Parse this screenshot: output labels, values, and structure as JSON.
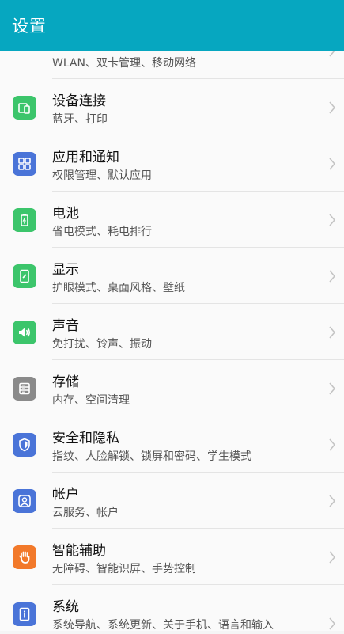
{
  "header": {
    "title": "设置"
  },
  "items": [
    {
      "key": "wlan",
      "title": "",
      "subtitle": "WLAN、双卡管理、移动网络",
      "icon": "wifi-icon",
      "color": "#4a74d8"
    },
    {
      "key": "device",
      "title": "设备连接",
      "subtitle": "蓝牙、打印",
      "icon": "device-connection-icon",
      "color": "#3cc56b"
    },
    {
      "key": "apps",
      "title": "应用和通知",
      "subtitle": "权限管理、默认应用",
      "icon": "apps-grid-icon",
      "color": "#4a74d8"
    },
    {
      "key": "battery",
      "title": "电池",
      "subtitle": "省电模式、耗电排行",
      "icon": "battery-icon",
      "color": "#3cc56b"
    },
    {
      "key": "display",
      "title": "显示",
      "subtitle": "护眼模式、桌面风格、壁纸",
      "icon": "display-icon",
      "color": "#3cc56b"
    },
    {
      "key": "sound",
      "title": "声音",
      "subtitle": "免打扰、铃声、振动",
      "icon": "speaker-icon",
      "color": "#3cc56b"
    },
    {
      "key": "storage",
      "title": "存储",
      "subtitle": "内存、空间清理",
      "icon": "storage-icon",
      "color": "#8a8a8a"
    },
    {
      "key": "security",
      "title": "安全和隐私",
      "subtitle": "指纹、人脸解锁、锁屏和密码、学生模式",
      "icon": "shield-icon",
      "color": "#4a74d8"
    },
    {
      "key": "accounts",
      "title": "帐户",
      "subtitle": "云服务、帐户",
      "icon": "account-icon",
      "color": "#4a74d8"
    },
    {
      "key": "assist",
      "title": "智能辅助",
      "subtitle": "无障碍、智能识屏、手势控制",
      "icon": "hand-icon",
      "color": "#f2792a"
    },
    {
      "key": "system",
      "title": "系统",
      "subtitle": "系统导航、系统更新、关于手机、语言和输入",
      "icon": "system-info-icon",
      "color": "#4a74d8"
    }
  ]
}
